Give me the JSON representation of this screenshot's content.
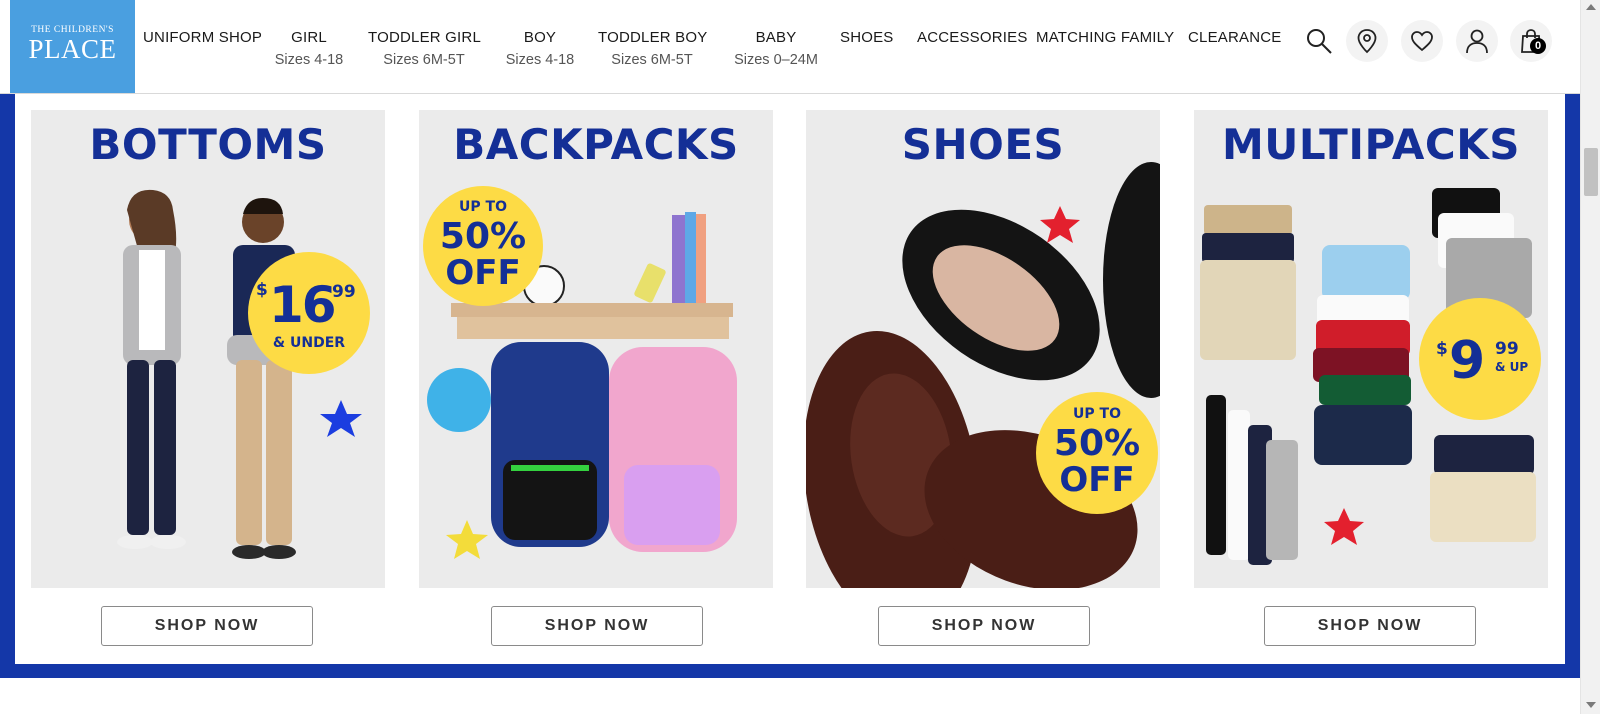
{
  "brand": {
    "logo_top": "THE CHILDREN'S",
    "logo_main": "PLACE",
    "color": "#4a9fe0"
  },
  "nav": {
    "items": [
      {
        "label": "UNIFORM SHOP",
        "sub": ""
      },
      {
        "label": "GIRL",
        "sub": "Sizes 4-18"
      },
      {
        "label": "TODDLER GIRL",
        "sub": "Sizes 6M-5T"
      },
      {
        "label": "BOY",
        "sub": "Sizes 4-18"
      },
      {
        "label": "TODDLER BOY",
        "sub": "Sizes 6M-5T"
      },
      {
        "label": "BABY",
        "sub": "Sizes 0–24M"
      },
      {
        "label": "SHOES",
        "sub": ""
      },
      {
        "label": "ACCESSORIES",
        "sub": ""
      },
      {
        "label": "MATCHING FAMILY",
        "sub": ""
      },
      {
        "label": "CLEARANCE",
        "sub": ""
      }
    ]
  },
  "header_icons": {
    "search": "search-icon",
    "store": "location-pin-icon",
    "wishlist": "heart-icon",
    "account": "user-icon",
    "cart": "shopping-bag-icon",
    "cart_count": "0"
  },
  "promo": {
    "accent_color": "#1437a8",
    "title_color": "#142f96",
    "badge_color": "#fddb45",
    "cards": [
      {
        "title": "BOTTOMS",
        "badge": {
          "currency": "$",
          "price": "16",
          "cents": "99",
          "note": "& UNDER"
        },
        "button": "SHOP NOW"
      },
      {
        "title": "BACKPACKS",
        "badge": {
          "line1": "UP TO",
          "line2": "50%",
          "line3": "OFF"
        },
        "button": "SHOP NOW"
      },
      {
        "title": "SHOES",
        "badge": {
          "line1": "UP TO",
          "line2": "50%",
          "line3": "OFF"
        },
        "button": "SHOP NOW"
      },
      {
        "title": "MULTIPACKS",
        "badge": {
          "currency": "$",
          "price": "9",
          "cents": "99",
          "note": "& UP"
        },
        "button": "SHOP NOW"
      }
    ]
  }
}
